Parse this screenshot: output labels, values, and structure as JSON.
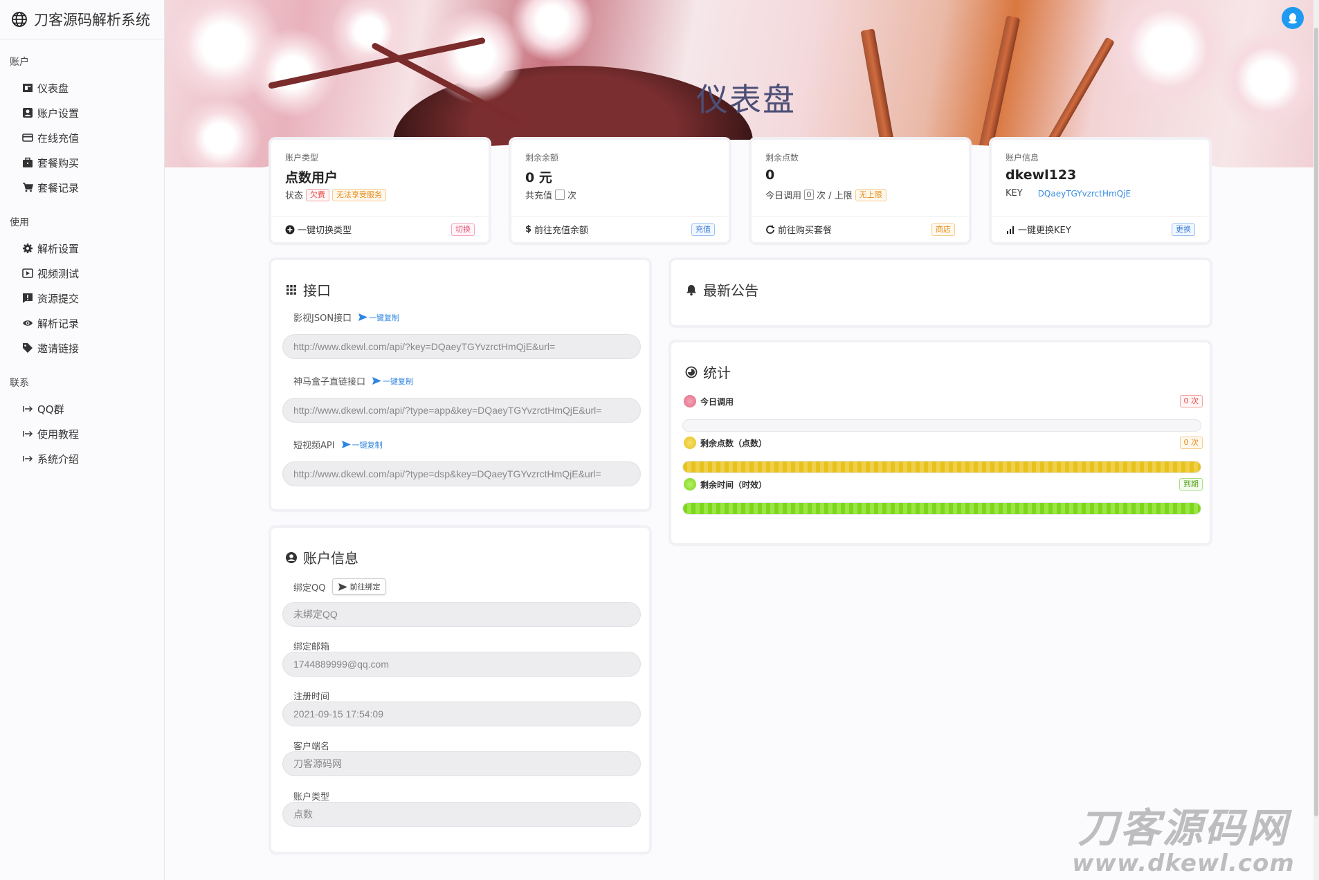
{
  "app": {
    "title": "刀客源码解析系统"
  },
  "sidebar": {
    "sections": [
      {
        "label": "账户",
        "items": [
          {
            "label": "仪表盘",
            "icon": "dashboard-icon"
          },
          {
            "label": "账户设置",
            "icon": "account-icon"
          },
          {
            "label": "在线充值",
            "icon": "card-icon"
          },
          {
            "label": "套餐购买",
            "icon": "bag-icon"
          },
          {
            "label": "套餐记录",
            "icon": "cart-icon"
          }
        ]
      },
      {
        "label": "使用",
        "items": [
          {
            "label": "解析设置",
            "icon": "gear-icon"
          },
          {
            "label": "视频测试",
            "icon": "play-icon"
          },
          {
            "label": "资源提交",
            "icon": "alert-icon"
          },
          {
            "label": "解析记录",
            "icon": "eye-icon"
          },
          {
            "label": "邀请链接",
            "icon": "tag-icon"
          }
        ]
      },
      {
        "label": "联系",
        "items": [
          {
            "label": "QQ群",
            "icon": "arrow-right-icon"
          },
          {
            "label": "使用教程",
            "icon": "arrow-right-icon"
          },
          {
            "label": "系统介绍",
            "icon": "arrow-right-icon"
          }
        ]
      }
    ]
  },
  "banner": {
    "title": "仪表盘"
  },
  "stats": {
    "account_type": {
      "label": "账户类型",
      "value": "点数用户",
      "status_label": "状态",
      "status_tag": "欠费",
      "status_note": "无法享受服务",
      "footer": "一键切换类型",
      "button": "切换"
    },
    "balance": {
      "label": "剩余余额",
      "value": "0 元",
      "recharged_label": "共充值",
      "recharged_unit": "次",
      "footer": "前往充值余额",
      "button": "充值"
    },
    "points": {
      "label": "剩余点数",
      "value": "0",
      "calls_label": "今日调用",
      "calls_value": "0",
      "calls_unit": "次 / 上限",
      "limit_tag": "无上限",
      "footer": "前往购买套餐",
      "button": "商店"
    },
    "info": {
      "label": "账户信息",
      "value": "dkewl123",
      "key_label": "KEY",
      "key_value": "DQaeyTGYvzrctHmQjE",
      "footer": "一键更换KEY",
      "button": "更换"
    }
  },
  "api": {
    "title": "接口",
    "copy_label": "一键复制",
    "items": [
      {
        "label": "影视JSON接口",
        "url": "http://www.dkewl.com/api/?key=DQaeyTGYvzrctHmQjE&url="
      },
      {
        "label": "神马盒子直链接口",
        "url": "http://www.dkewl.com/api/?type=app&key=DQaeyTGYvzrctHmQjE&url="
      },
      {
        "label": "短视频API",
        "url": "http://www.dkewl.com/api/?type=dsp&key=DQaeyTGYvzrctHmQjE&url="
      }
    ]
  },
  "account": {
    "title": "账户信息",
    "bind_button": "前往绑定",
    "fields": [
      {
        "label": "绑定QQ",
        "value": "未绑定QQ"
      },
      {
        "label": "绑定邮箱",
        "value": "1744889999@qq.com"
      },
      {
        "label": "注册时间",
        "value": "2021-09-15 17:54:09"
      },
      {
        "label": "客户端名",
        "value": "刀客源码网"
      },
      {
        "label": "账户类型",
        "value": "点数"
      }
    ]
  },
  "notice": {
    "title": "最新公告"
  },
  "stats_panel": {
    "title": "统计",
    "rows": [
      {
        "label": "今日调用",
        "tag": "0 次",
        "color": "#e66a86",
        "progress": 0
      },
      {
        "label": "剩余点数（点数）",
        "tag": "0 次",
        "color": "#e8c21c",
        "progress": 1
      },
      {
        "label": "剩余时间（时效）",
        "tag": "到期",
        "color": "#7ed61c",
        "progress": 1
      }
    ]
  },
  "watermark": {
    "line1": "刀客源码网",
    "line2": "www.dkewl.com"
  },
  "colors": {
    "accent": "#3a8ee6",
    "danger": "#e84848",
    "warning": "#e68a1a",
    "success": "#52a01a",
    "title": "#4c4f77"
  }
}
